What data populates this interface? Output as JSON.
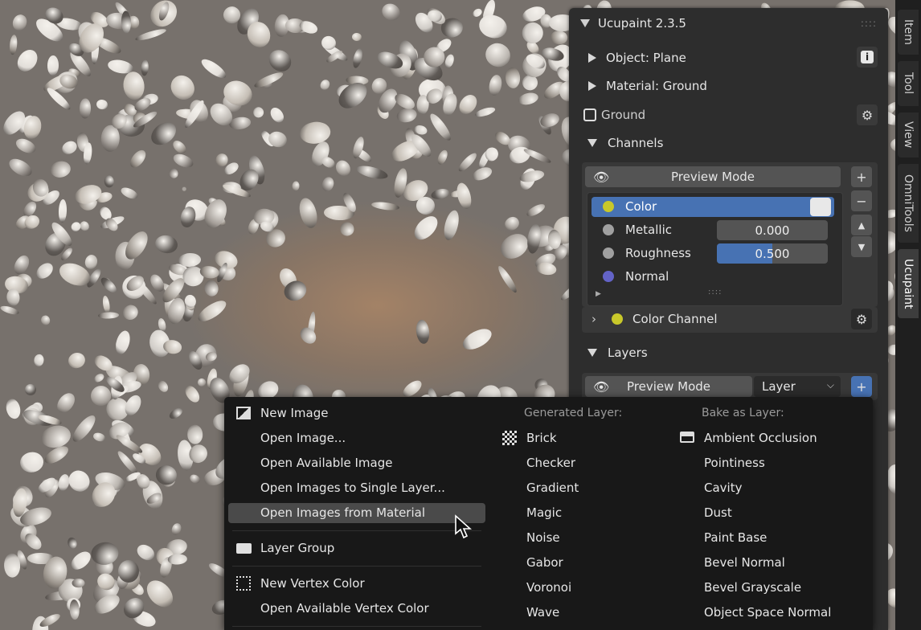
{
  "panel": {
    "title": "Ucupaint 2.3.5",
    "object_label": "Object: Plane",
    "material_label": "Material: Ground",
    "node_label": "Ground"
  },
  "channels": {
    "header": "Channels",
    "preview_mode": "Preview Mode",
    "items": [
      {
        "name": "Color",
        "color": "#c8c82a",
        "value": ""
      },
      {
        "name": "Metallic",
        "color": "#a0a0a0",
        "value": "0.000"
      },
      {
        "name": "Roughness",
        "color": "#a0a0a0",
        "value": "0.500"
      },
      {
        "name": "Normal",
        "color": "#6363c7",
        "value": ""
      }
    ],
    "active_channel": "Color Channel"
  },
  "layers": {
    "header": "Layers",
    "preview_mode": "Preview Mode",
    "dropdown_value": "Layer"
  },
  "tabs": [
    "Item",
    "Tool",
    "View",
    "OmniTools",
    "Ucupaint"
  ],
  "menu": {
    "col1": [
      {
        "label": "New Image",
        "icon": "image-icon"
      },
      {
        "label": "Open Image...",
        "icon": ""
      },
      {
        "label": "Open Available Image",
        "icon": ""
      },
      {
        "label": "Open Images to Single Layer...",
        "icon": ""
      },
      {
        "label": "Open Images from Material",
        "icon": ""
      },
      {
        "label": "Layer Group",
        "icon": "folder-icon"
      },
      {
        "label": "New Vertex Color",
        "icon": "vertex-color-icon"
      },
      {
        "label": "Open Available Vertex Color",
        "icon": ""
      }
    ],
    "generated_header": "Generated Layer:",
    "generated": [
      "Brick",
      "Checker",
      "Gradient",
      "Magic",
      "Noise",
      "Gabor",
      "Voronoi",
      "Wave"
    ],
    "bake_header": "Bake as Layer:",
    "bake": [
      "Ambient Occlusion",
      "Pointiness",
      "Cavity",
      "Dust",
      "Paint Base",
      "Bevel Normal",
      "Bevel Grayscale",
      "Object Space Normal"
    ]
  },
  "colors": {
    "accent_blue": "#4772b3",
    "panel_bg": "#2d2d2d",
    "menu_bg": "#181818"
  },
  "roughness_fill": 0.5
}
